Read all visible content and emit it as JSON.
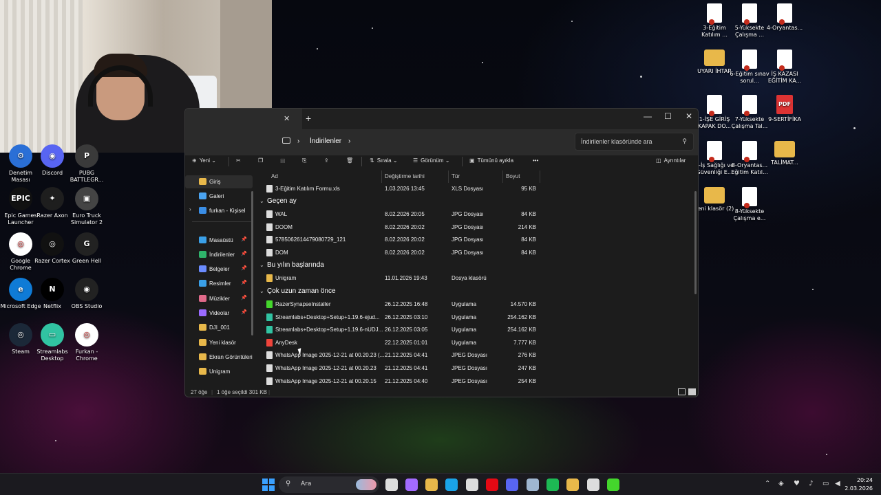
{
  "explorer": {
    "tab_close": "✕",
    "tab_new": "+",
    "win_min": "—",
    "win_max": "☐",
    "win_close": "✕",
    "breadcrumb": [
      "İndirilenler"
    ],
    "crumb_sep": "›",
    "search_placeholder": "İndirilenler klasöründe ara",
    "toolbar": {
      "new": "Yeni",
      "sort": "Sırala",
      "view": "Görünüm",
      "select_all": "Tümünü ayıkla",
      "more": "•••",
      "details": "Ayrıntılar"
    },
    "nav": [
      {
        "label": "Giriş",
        "color": "#e8b84a",
        "active": true
      },
      {
        "label": "Galeri",
        "color": "#4aa3f0"
      },
      {
        "label": "furkan - Kişisel",
        "color": "#3a8ee6"
      },
      {
        "label": "Masaüstü",
        "color": "#3aa0e8",
        "pin": "📌"
      },
      {
        "label": "İndirilenler",
        "color": "#2fb36b",
        "pin": "📌"
      },
      {
        "label": "Belgeler",
        "color": "#6b8cff",
        "pin": "📌"
      },
      {
        "label": "Resimler",
        "color": "#3aa0e8",
        "pin": "📌"
      },
      {
        "label": "Müzikler",
        "color": "#e06a8a",
        "pin": "📌"
      },
      {
        "label": "Videolar",
        "color": "#9a6bff",
        "pin": "📌"
      },
      {
        "label": "DJI_001",
        "color": "#e8b84a"
      },
      {
        "label": "Yeni klasör",
        "color": "#e8b84a"
      },
      {
        "label": "Ekran Görüntüleri",
        "color": "#e8b84a"
      },
      {
        "label": "Unigram",
        "color": "#e8b84a"
      }
    ],
    "columns": [
      "Ad",
      "Değiştirme tarihi",
      "Tür",
      "Boyut"
    ],
    "rows_top": [
      {
        "name": "3-Eğitim Katılım Formu.xls",
        "date": "1.03.2026 13:45",
        "type": "XLS Dosyası",
        "size": "95 KB",
        "color": "#ddd"
      }
    ],
    "groups": [
      {
        "title": "Geçen ay",
        "rows": [
          {
            "name": "WAL",
            "date": "8.02.2026 20:05",
            "type": "JPG Dosyası",
            "size": "84 KB",
            "color": "#ddd"
          },
          {
            "name": "DOOM",
            "date": "8.02.2026 20:02",
            "type": "JPG Dosyası",
            "size": "214 KB",
            "color": "#ddd"
          },
          {
            "name": "5785062614479080729_121",
            "date": "8.02.2026 20:02",
            "type": "JPG Dosyası",
            "size": "84 KB",
            "color": "#ddd"
          },
          {
            "name": "DOM",
            "date": "8.02.2026 20:02",
            "type": "JPG Dosyası",
            "size": "84 KB",
            "color": "#ddd"
          }
        ]
      },
      {
        "title": "Bu yılın başlarında",
        "rows": [
          {
            "name": "Unigram",
            "date": "11.01.2026 19:43",
            "type": "Dosya klasörü",
            "size": "",
            "color": "#e8b84a"
          }
        ]
      },
      {
        "title": "Çok uzun zaman önce",
        "rows": [
          {
            "name": "RazerSynapseInstaller",
            "date": "26.12.2025 16:48",
            "type": "Uygulama",
            "size": "14.570 KB",
            "color": "#44d62c"
          },
          {
            "name": "Streamlabs+Desktop+Setup+1.19.6-ejud...",
            "date": "26.12.2025 03:10",
            "type": "Uygulama",
            "size": "254.162 KB",
            "color": "#31c3a2"
          },
          {
            "name": "Streamlabs+Desktop+Setup+1.19.6-nUDJ...",
            "date": "26.12.2025 03:05",
            "type": "Uygulama",
            "size": "254.162 KB",
            "color": "#31c3a2"
          },
          {
            "name": "AnyDesk",
            "date": "22.12.2025 01:01",
            "type": "Uygulama",
            "size": "7.777 KB",
            "color": "#ef443b"
          },
          {
            "name": "WhatsApp Image 2025-12-21 at 00.20.23 (...",
            "date": "21.12.2025 04:41",
            "type": "JPEG Dosyası",
            "size": "276 KB",
            "color": "#ddd"
          },
          {
            "name": "WhatsApp Image 2025-12-21 at 00.20.23",
            "date": "21.12.2025 04:41",
            "type": "JPEG Dosyası",
            "size": "247 KB",
            "color": "#ddd"
          },
          {
            "name": "WhatsApp Image 2025-12-21 at 00.20.15",
            "date": "21.12.2025 04:40",
            "type": "JPEG Dosyası",
            "size": "254 KB",
            "color": "#ddd"
          }
        ]
      }
    ],
    "status": {
      "count": "27 öğe",
      "selected": "1 öğe seçildi  301 KB"
    }
  },
  "desktop_left": [
    {
      "label": "Denetim Masası",
      "bg": "#2a6fd6",
      "glyph": "⚙"
    },
    {
      "label": "Discord",
      "bg": "#5865f2",
      "glyph": "◉"
    },
    {
      "label": "PUBG BATTLEGR...",
      "bg": "#3a3a3a",
      "glyph": "P"
    },
    {
      "label": "Epic Games Launcher",
      "bg": "#111",
      "glyph": "EPIC"
    },
    {
      "label": "Razer Axon",
      "bg": "#1e1e1e",
      "glyph": "✦"
    },
    {
      "label": "Euro Truck Simulator 2",
      "bg": "#444",
      "glyph": "▣"
    },
    {
      "label": "Google Chrome",
      "bg": "#fff",
      "glyph": "◎"
    },
    {
      "label": "Razer Cortex",
      "bg": "#111",
      "glyph": "◎"
    },
    {
      "label": "Green Hell",
      "bg": "#222",
      "glyph": "G"
    },
    {
      "label": "Microsoft Edge",
      "bg": "#0f7bd6",
      "glyph": "e"
    },
    {
      "label": "Netflix",
      "bg": "#000",
      "glyph": "N"
    },
    {
      "label": "OBS Studio",
      "bg": "#222",
      "glyph": "◉"
    },
    {
      "label": "Steam",
      "bg": "#1b2838",
      "glyph": "◎"
    },
    {
      "label": "Streamlabs Desktop",
      "bg": "#31c3a2",
      "glyph": "▭"
    },
    {
      "label": "Furkan - Chrome",
      "bg": "#fff",
      "glyph": "◎"
    }
  ],
  "desktop_right": [
    {
      "label": "3-Eğitim Katılım ...",
      "kind": "doc"
    },
    {
      "label": "5-Yüksekte Çalışma ...",
      "kind": "doc"
    },
    {
      "label": "4-Oryantas...",
      "kind": "doc"
    },
    {
      "label": "UYARI İHTAR",
      "kind": "folder"
    },
    {
      "label": "6-Eğitim sınav sorul...",
      "kind": "doc"
    },
    {
      "label": "İŞ KAZASI EĞİTİM KA...",
      "kind": "doc"
    },
    {
      "label": "1-İŞE GİRİŞ KAPAK DO...",
      "kind": "doc"
    },
    {
      "label": "7-Yüksekte Çalışma Tal...",
      "kind": "doc"
    },
    {
      "label": "9-SERTİFİKA",
      "kind": "pdf",
      "glyph": "PDF"
    },
    {
      "label": "2-İş Sağlığı ve Güvenliği E...",
      "kind": "doc"
    },
    {
      "label": "8-Oryantas... Eğitim Katıl...",
      "kind": "doc"
    },
    {
      "label": "TALİMAT...",
      "kind": "folder"
    },
    {
      "label": "Yeni klasör (2)",
      "kind": "folder"
    },
    {
      "label": "8-Yüksekte Çalışma e...",
      "kind": "doc"
    }
  ],
  "taskbar": {
    "search_label": "Ara",
    "apps": [
      {
        "name": "windows",
        "color": "#3aa0ff"
      },
      {
        "name": "task-view",
        "color": "#ddd"
      },
      {
        "name": "copilot",
        "color": "#a36bff"
      },
      {
        "name": "file-explorer",
        "color": "#e8b84a"
      },
      {
        "name": "edge",
        "color": "#1aa3e8"
      },
      {
        "name": "store",
        "color": "#ddd"
      },
      {
        "name": "netflix",
        "color": "#e50914"
      },
      {
        "name": "discord",
        "color": "#5865f2"
      },
      {
        "name": "steam",
        "color": "#9fb6d0"
      },
      {
        "name": "spotify",
        "color": "#1db954"
      },
      {
        "name": "chrome",
        "color": "#e8b84a"
      },
      {
        "name": "obs",
        "color": "#ddd"
      },
      {
        "name": "razer",
        "color": "#44d62c"
      }
    ],
    "time": "20:24",
    "date": "2.03.2026"
  }
}
